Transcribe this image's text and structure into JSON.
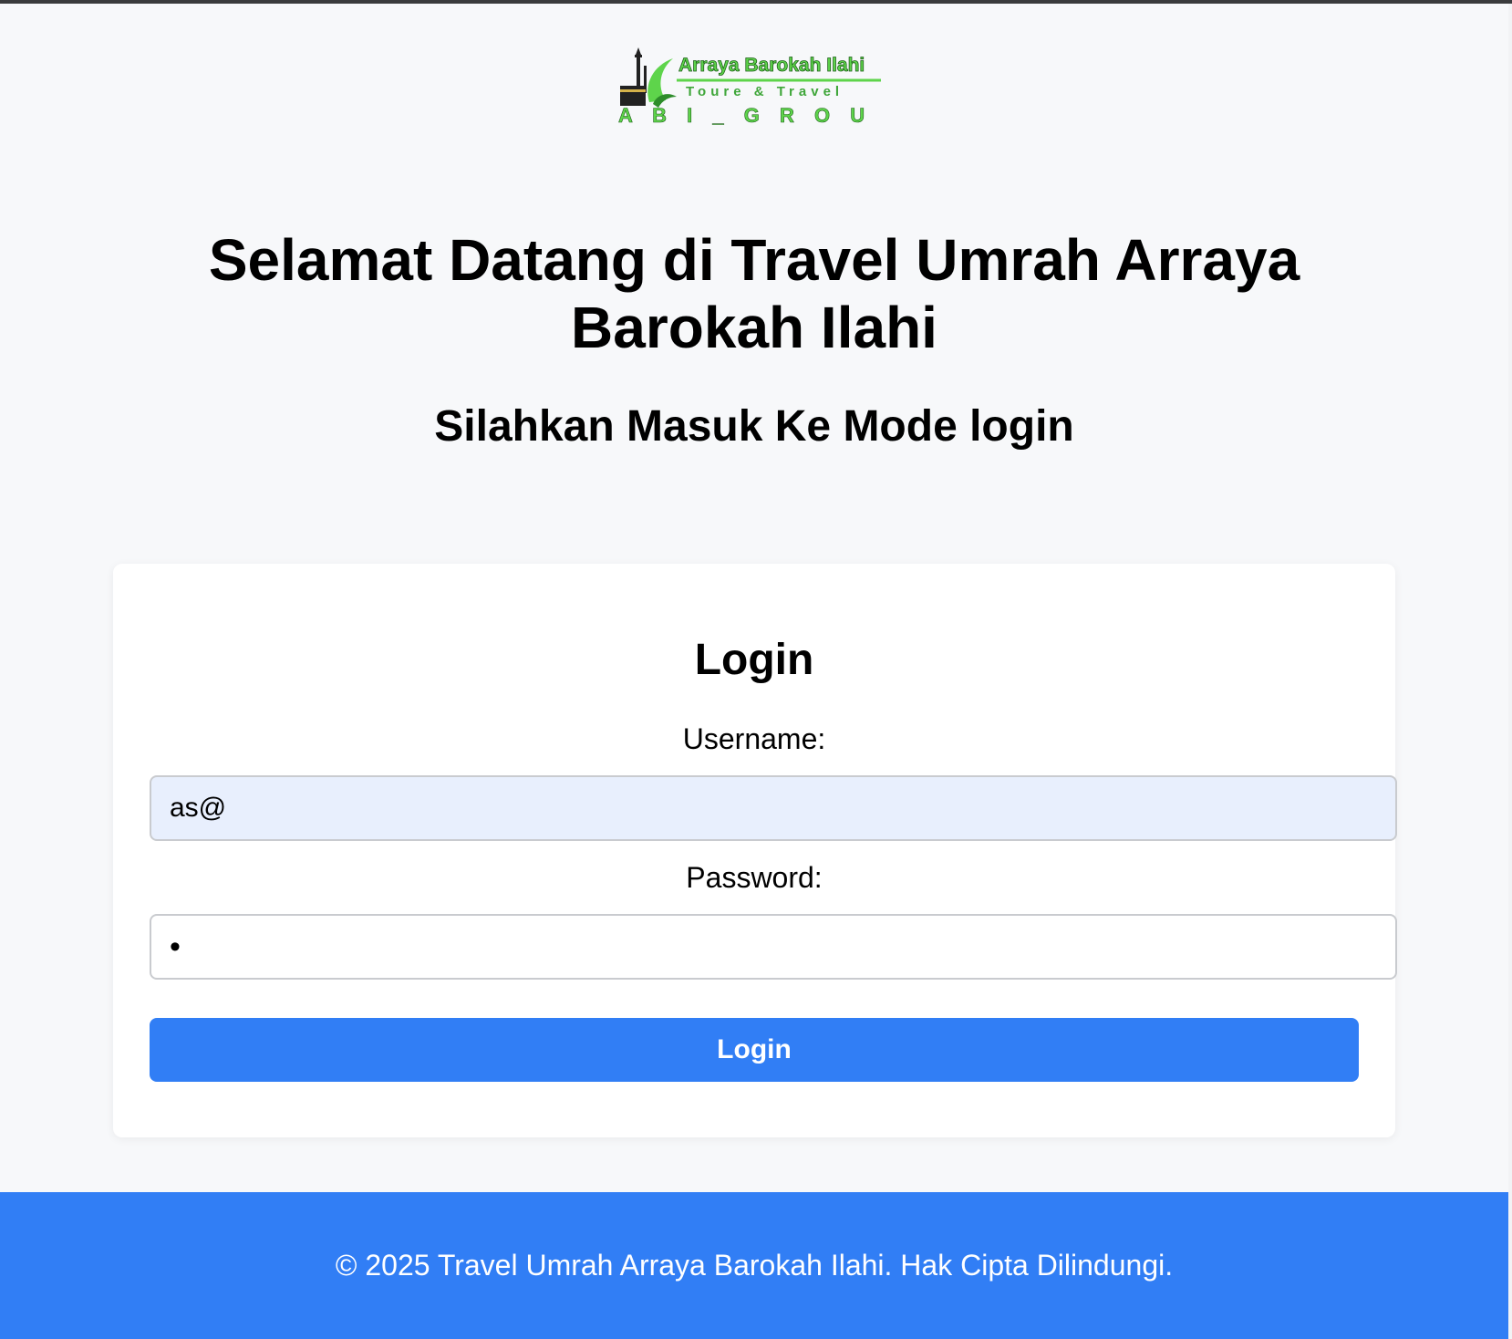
{
  "logo": {
    "name": "Arraya Barokah Ilahi",
    "tagline": "Toure & Travel",
    "group": "A B I _ G R O U P",
    "colors": {
      "green": "#5ed44b",
      "dark": "#222222"
    }
  },
  "header": {
    "title": "Selamat Datang di Travel Umrah Arraya Barokah Ilahi",
    "subtitle": "Silahkan Masuk Ke Mode login"
  },
  "login_form": {
    "heading": "Login",
    "username_label": "Username:",
    "username_value": "as@",
    "password_label": "Password:",
    "password_value": "a",
    "submit_label": "Login"
  },
  "footer": {
    "text": "© 2025 Travel Umrah Arraya Barokah Ilahi. Hak Cipta Dilindungi."
  },
  "colors": {
    "primary": "#317ef5",
    "background": "#f7f8fa",
    "autofill": "#e8effd"
  }
}
